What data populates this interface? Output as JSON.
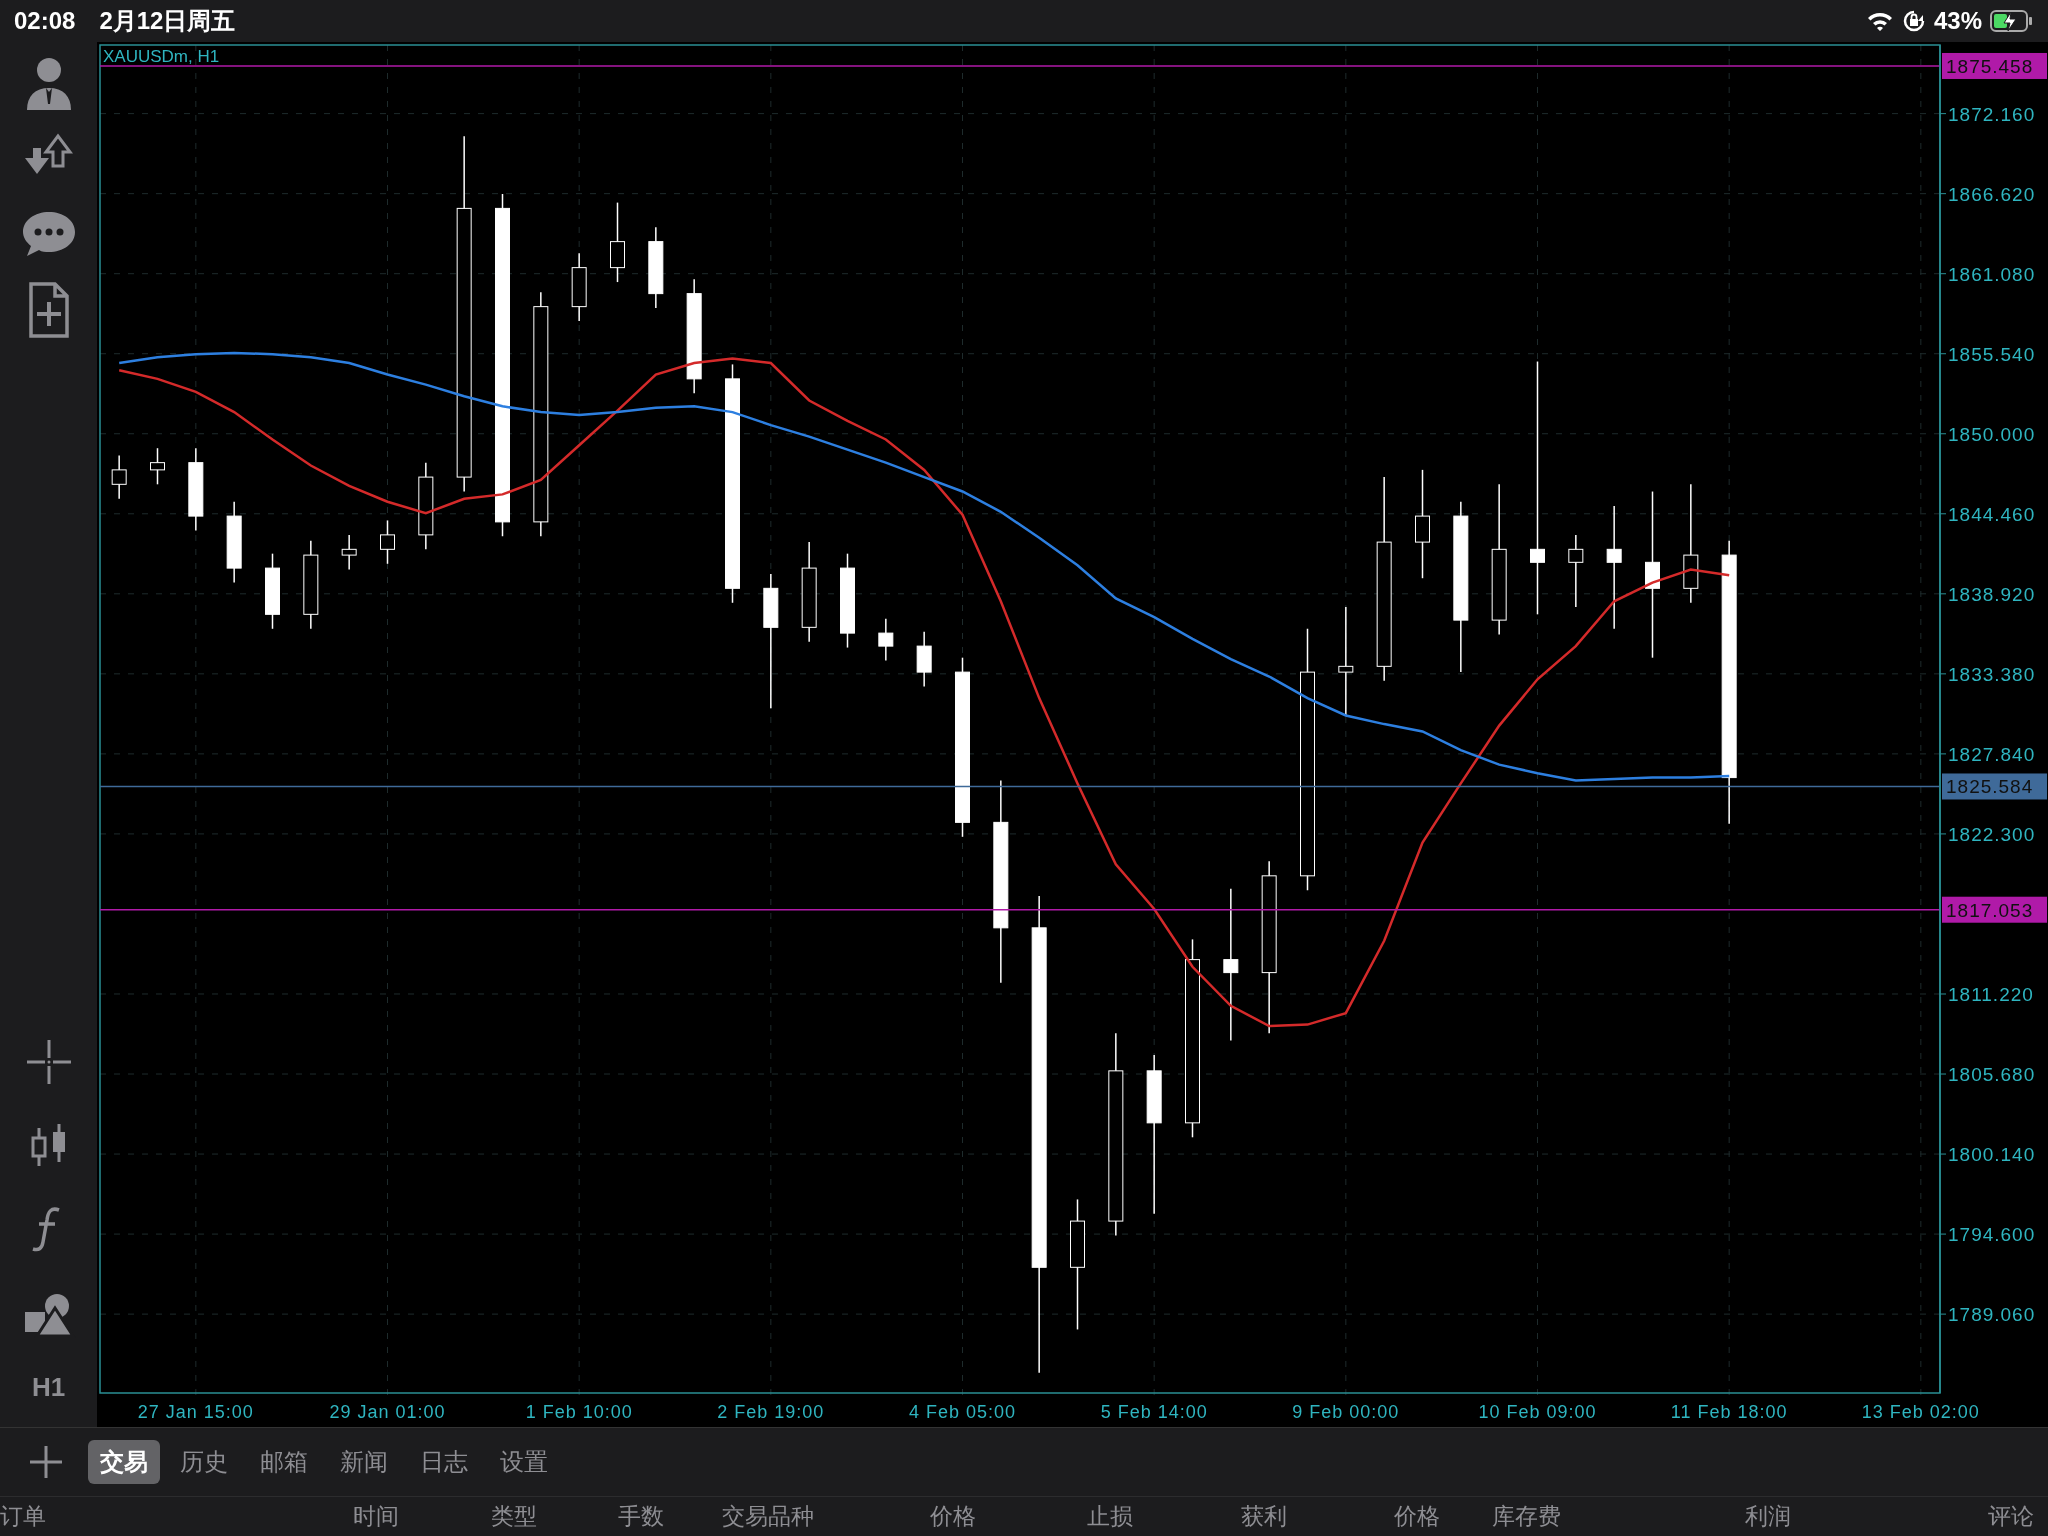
{
  "status_bar": {
    "time": "02:08",
    "date": "2月12日周五",
    "battery": "43%"
  },
  "toolbar": {
    "timeframe": "H1"
  },
  "chart": {
    "symbol_label": "XAUUSDm, H1",
    "chart_data": {
      "type": "candlestick",
      "categories": [
        null,
        null,
        "27 Jan 15:00",
        null,
        null,
        null,
        null,
        "29 Jan 01:00",
        null,
        null,
        null,
        null,
        "1 Feb 10:00",
        null,
        null,
        null,
        null,
        "2 Feb 19:00",
        null,
        null,
        null,
        null,
        "4 Feb 05:00",
        null,
        null,
        null,
        null,
        "5 Feb 14:00",
        null,
        null,
        null,
        null,
        "9 Feb 00:00",
        null,
        null,
        null,
        null,
        "10 Feb 09:00",
        null,
        null,
        null,
        null,
        "11 Feb 18:00",
        null,
        null,
        null,
        null,
        "13 Feb 02:00"
      ],
      "ohlc": [
        [
          1846.5,
          1848.5,
          1845.5,
          1847.5
        ],
        [
          1847.5,
          1849.0,
          1846.5,
          1848.0
        ],
        [
          1848.0,
          1849.0,
          1843.3,
          1844.3
        ],
        [
          1844.3,
          1845.3,
          1839.7,
          1840.7
        ],
        [
          1840.7,
          1841.7,
          1836.5,
          1837.5
        ],
        [
          1837.5,
          1842.6,
          1836.5,
          1841.6
        ],
        [
          1841.6,
          1843.0,
          1840.6,
          1842.0
        ],
        [
          1842.0,
          1844.0,
          1841.0,
          1843.0
        ],
        [
          1843.0,
          1848.0,
          1842.0,
          1847.0
        ],
        [
          1847.0,
          1870.6,
          1846.0,
          1865.6
        ],
        [
          1865.6,
          1866.6,
          1842.9,
          1843.9
        ],
        [
          1843.9,
          1859.8,
          1842.9,
          1858.8
        ],
        [
          1858.8,
          1862.5,
          1857.8,
          1861.5
        ],
        [
          1861.5,
          1866.0,
          1860.5,
          1863.3
        ],
        [
          1863.3,
          1864.3,
          1858.7,
          1859.7
        ],
        [
          1859.7,
          1860.7,
          1852.8,
          1853.8
        ],
        [
          1853.8,
          1854.8,
          1838.3,
          1839.3
        ],
        [
          1839.3,
          1840.3,
          1831.0,
          1836.6
        ],
        [
          1836.6,
          1842.5,
          1835.6,
          1840.7
        ],
        [
          1840.7,
          1841.7,
          1835.2,
          1836.2
        ],
        [
          1836.2,
          1837.2,
          1834.3,
          1835.3
        ],
        [
          1835.3,
          1836.3,
          1832.5,
          1833.5
        ],
        [
          1833.5,
          1834.5,
          1822.1,
          1823.1
        ],
        [
          1823.1,
          1826.0,
          1812.0,
          1815.8
        ],
        [
          1815.8,
          1818.0,
          1785.0,
          1792.3
        ],
        [
          1792.3,
          1797.0,
          1788.0,
          1795.5
        ],
        [
          1795.5,
          1808.5,
          1794.5,
          1805.9
        ],
        [
          1805.9,
          1807.0,
          1796.0,
          1802.3
        ],
        [
          1802.3,
          1815.0,
          1801.3,
          1813.6
        ],
        [
          1813.6,
          1818.5,
          1808.0,
          1812.7
        ],
        [
          1812.7,
          1820.4,
          1808.5,
          1819.4
        ],
        [
          1819.4,
          1836.5,
          1818.4,
          1833.5
        ],
        [
          1833.5,
          1838.0,
          1830.5,
          1833.9
        ],
        [
          1833.9,
          1847.0,
          1832.9,
          1842.5
        ],
        [
          1842.5,
          1847.5,
          1840.0,
          1844.3
        ],
        [
          1844.3,
          1845.3,
          1833.5,
          1837.1
        ],
        [
          1837.1,
          1846.5,
          1836.1,
          1842.0
        ],
        [
          1842.0,
          1855.0,
          1837.5,
          1841.1
        ],
        [
          1841.1,
          1843.0,
          1838.0,
          1842.0
        ],
        [
          1842.0,
          1845.0,
          1836.5,
          1841.1
        ],
        [
          1841.1,
          1846.0,
          1834.5,
          1839.3
        ],
        [
          1839.3,
          1846.5,
          1838.3,
          1841.6
        ],
        [
          1841.6,
          1842.6,
          1823.0,
          1826.2
        ],
        null,
        null,
        null,
        null,
        null
      ],
      "series": [
        {
          "type": "line",
          "color": "#d42a2a",
          "values": [
            1854.4,
            1853.8,
            1852.9,
            1851.5,
            1849.6,
            1847.8,
            1846.4,
            1845.3,
            1844.5,
            1845.5,
            1845.8,
            1846.8,
            1849.2,
            1851.6,
            1854.1,
            1854.9,
            1855.2,
            1854.9,
            1852.3,
            1850.9,
            1849.6,
            1847.5,
            1844.4,
            1838.4,
            1831.7,
            1825.8,
            1820.2,
            1817.1,
            1813.1,
            1810.4,
            1809.0,
            1809.1,
            1809.9,
            1814.9,
            1821.7,
            1825.8,
            1829.8,
            1833.0,
            1835.3,
            1838.4,
            1839.7,
            1840.6,
            1840.2,
            null,
            null,
            null,
            null,
            null
          ]
        },
        {
          "type": "line",
          "color": "#2d7fe0",
          "values": [
            1854.9,
            1855.3,
            1855.5,
            1855.6,
            1855.5,
            1855.3,
            1854.9,
            1854.1,
            1853.4,
            1852.6,
            1851.9,
            1851.5,
            1851.3,
            1851.5,
            1851.8,
            1851.9,
            1851.5,
            1850.6,
            1849.8,
            1848.9,
            1848.0,
            1847.0,
            1846.0,
            1844.6,
            1842.8,
            1840.9,
            1838.6,
            1837.3,
            1835.8,
            1834.4,
            1833.2,
            1831.7,
            1830.5,
            1829.9,
            1829.4,
            1828.1,
            1827.1,
            1826.5,
            1826.0,
            1826.1,
            1826.2,
            1826.2,
            1826.3,
            null,
            null,
            null,
            null,
            null
          ]
        }
      ],
      "ylim": [
        1783.6,
        1876.91
      ],
      "grid": true,
      "yticks": [
        {
          "value": 1872.16,
          "label": "1872.160"
        },
        {
          "value": 1866.62,
          "label": "1866.620"
        },
        {
          "value": 1861.08,
          "label": "1861.080"
        },
        {
          "value": 1855.54,
          "label": "1855.540"
        },
        {
          "value": 1850.0,
          "label": "1850.000"
        },
        {
          "value": 1844.46,
          "label": "1844.460"
        },
        {
          "value": 1838.92,
          "label": "1838.920"
        },
        {
          "value": 1833.38,
          "label": "1833.380"
        },
        {
          "value": 1827.84,
          "label": "1827.840"
        },
        {
          "value": 1822.3,
          "label": "1822.300"
        },
        {
          "value": 1811.22,
          "label": "1811.220"
        },
        {
          "value": 1805.68,
          "label": "1805.680"
        },
        {
          "value": 1800.14,
          "label": "1800.140"
        },
        {
          "value": 1794.6,
          "label": "1794.600"
        },
        {
          "value": 1789.06,
          "label": "1789.060"
        }
      ],
      "ref_lines": [
        {
          "axis": "y",
          "value": 1875.458,
          "label": "1875.458",
          "color": "#b01aa8"
        },
        {
          "axis": "y",
          "value": 1825.584,
          "label": "1825.584",
          "color": "#3f6a99"
        },
        {
          "axis": "y",
          "value": 1817.053,
          "label": "1817.053",
          "color": "#b01aa8"
        }
      ]
    }
  },
  "tabs": [
    {
      "label": "交易",
      "selected": true
    },
    {
      "label": "历史",
      "selected": false
    },
    {
      "label": "邮箱",
      "selected": false
    },
    {
      "label": "新闻",
      "selected": false
    },
    {
      "label": "日志",
      "selected": false
    },
    {
      "label": "设置",
      "selected": false
    }
  ],
  "table": {
    "columns": [
      "订单",
      "时间",
      "类型",
      "手数",
      "交易品种",
      "价格",
      "止损",
      "获利",
      "价格",
      "库存费",
      "利润",
      "评论"
    ]
  }
}
